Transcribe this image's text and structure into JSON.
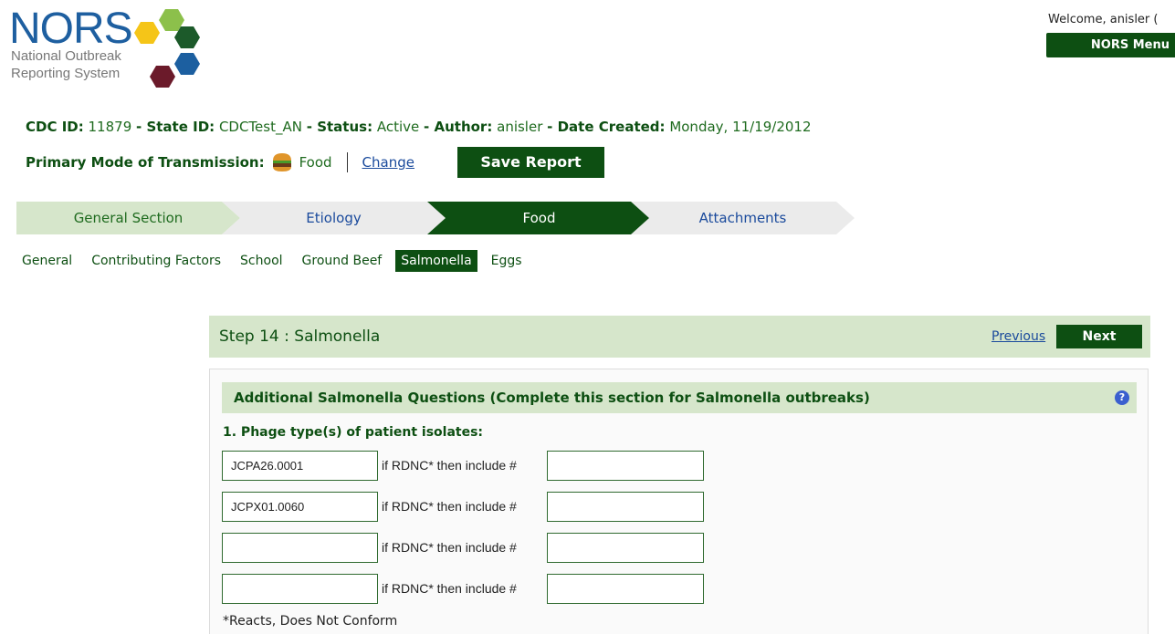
{
  "logo": {
    "title": "NORS",
    "subtitle_line1": "National Outbreak",
    "subtitle_line2": "Reporting System"
  },
  "header": {
    "welcome": "Welcome, anisler (",
    "menu_label": "NORS Menu"
  },
  "report_info": {
    "cdc_id_label": "CDC ID:",
    "cdc_id": "11879",
    "state_id_label": "- State ID:",
    "state_id": "CDCTest_AN",
    "status_label": "- Status:",
    "status": "Active",
    "author_label": "- Author:",
    "author": "anisler",
    "date_label": "- Date Created:",
    "date": "Monday, 11/19/2012"
  },
  "transmission": {
    "label": "Primary Mode of Transmission:",
    "icon": "hamburger-icon",
    "value": "Food",
    "change_label": "Change",
    "save_label": "Save Report"
  },
  "tabs": [
    {
      "label": "General Section"
    },
    {
      "label": "Etiology"
    },
    {
      "label": "Food"
    },
    {
      "label": "Attachments"
    }
  ],
  "subtabs": [
    {
      "label": "General"
    },
    {
      "label": "Contributing Factors"
    },
    {
      "label": "School"
    },
    {
      "label": "Ground Beef"
    },
    {
      "label": "Salmonella"
    },
    {
      "label": "Eggs"
    }
  ],
  "step": {
    "title": "Step 14 : Salmonella",
    "previous_label": "Previous",
    "next_label": "Next"
  },
  "section": {
    "title": "Additional Salmonella Questions (Complete this section for Salmonella outbreaks)",
    "help_icon": "help-icon",
    "question1": "1. Phage type(s) of patient isolates:",
    "rdnc_label": "if RDNC* then include #",
    "rows": [
      {
        "phage": "JCPA26.0001",
        "rdnc": ""
      },
      {
        "phage": "JCPX01.0060",
        "rdnc": ""
      },
      {
        "phage": "",
        "rdnc": ""
      },
      {
        "phage": "",
        "rdnc": ""
      }
    ],
    "footnote": "*Reacts, Does Not Conform"
  },
  "colors": {
    "dark_green": "#0d4f12",
    "light_green": "#d6e6cb",
    "link_blue": "#1a4a9c"
  }
}
